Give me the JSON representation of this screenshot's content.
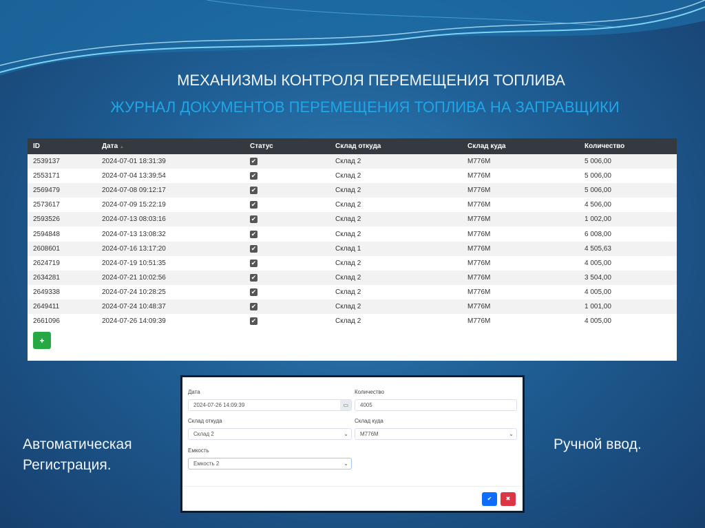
{
  "title": "МЕХАНИЗМЫ КОНТРОЛЯ ПЕРЕМЕЩЕНИЯ ТОПЛИВА",
  "subtitle": "ЖУРНАЛ ДОКУМЕНТОВ ПЕРЕМЕЩЕНИЯ ТОПЛИВА НА ЗАПРАВЩИКИ",
  "table": {
    "headers": [
      "ID",
      "Дата",
      "Статус",
      "Склад откуда",
      "Склад куда",
      "Количество"
    ],
    "sort_icon": "▲",
    "rows": [
      [
        "2539137",
        "2024-07-01 18:31:39",
        "✔",
        "Склад 2",
        "М776М",
        "5 006,00"
      ],
      [
        "2553171",
        "2024-07-04 13:39:54",
        "✔",
        "Склад 2",
        "М776М",
        "5 006,00"
      ],
      [
        "2569479",
        "2024-07-08 09:12:17",
        "✔",
        "Склад 2",
        "М776М",
        "5 006,00"
      ],
      [
        "2573617",
        "2024-07-09 15:22:19",
        "✔",
        "Склад 2",
        "М776М",
        "4 506,00"
      ],
      [
        "2593526",
        "2024-07-13 08:03:16",
        "✔",
        "Склад 2",
        "М776М",
        "1 002,00"
      ],
      [
        "2594848",
        "2024-07-13 13:08:32",
        "✔",
        "Склад 2",
        "М776М",
        "6 008,00"
      ],
      [
        "2608601",
        "2024-07-16 13:17:20",
        "✔",
        "Склад 1",
        "М776М",
        "4 505,63"
      ],
      [
        "2624719",
        "2024-07-19 10:51:35",
        "✔",
        "Склад 2",
        "М776М",
        "4 005,00"
      ],
      [
        "2634281",
        "2024-07-21 10:02:56",
        "✔",
        "Склад 2",
        "М776М",
        "3 504,00"
      ],
      [
        "2649338",
        "2024-07-24 10:28:25",
        "✔",
        "Склад 2",
        "М776М",
        "4 005,00"
      ],
      [
        "2649411",
        "2024-07-24 10:48:37",
        "✔",
        "Склад 2",
        "М776М",
        "1 001,00"
      ],
      [
        "2661096",
        "2024-07-26 14:09:39",
        "✔",
        "Склад 2",
        "М776М",
        "4 005,00"
      ]
    ],
    "add_label": "+"
  },
  "left_caption": [
    "Автоматическая",
    "Регистрация."
  ],
  "right_caption": "Ручной ввод.",
  "form": {
    "date_label": "Дата",
    "date_value": "2024-07-26 14:09:39",
    "calendar_icon": "▭",
    "qty_label": "Количество",
    "qty_value": "4005",
    "from_label": "Склад откуда",
    "from_value": "Склад 2",
    "to_label": "Склад куда",
    "to_value": "М776М",
    "tank_label": "Емкость",
    "tank_value": "Емкость 2",
    "chevron": "⌄",
    "ok_label": "✔",
    "cancel_label": "✖"
  }
}
